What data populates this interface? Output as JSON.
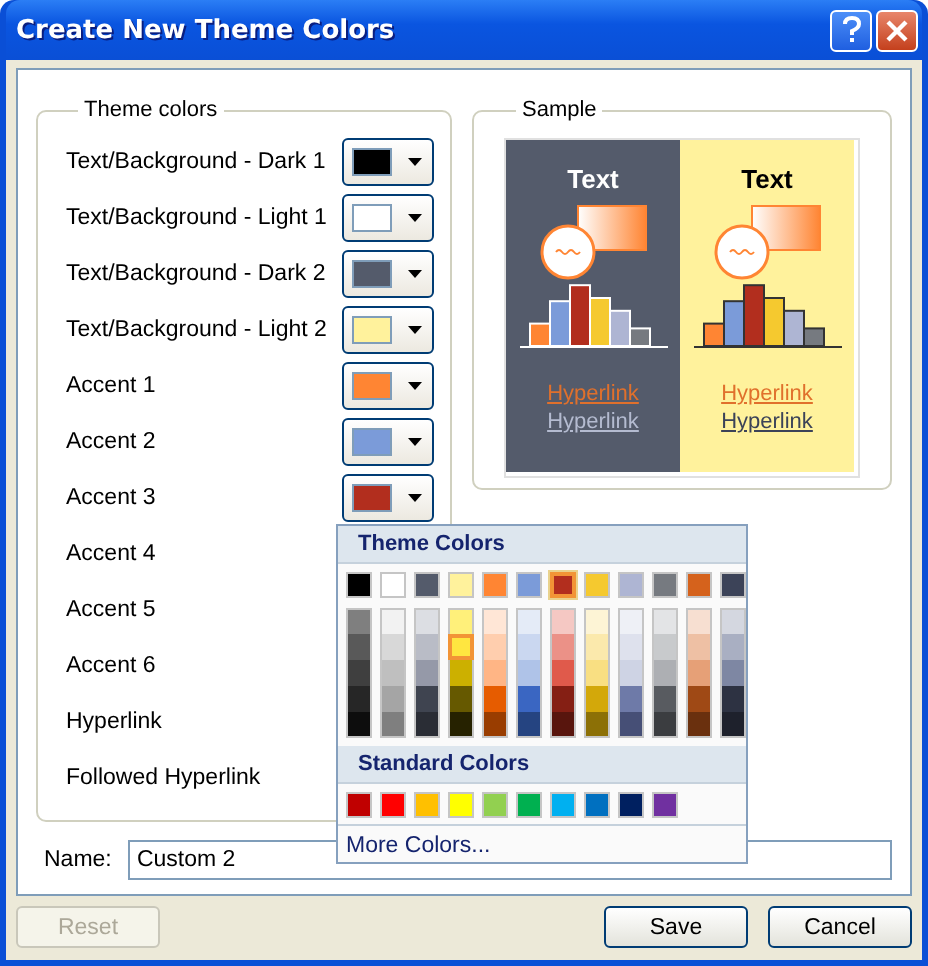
{
  "window": {
    "title": "Create New Theme Colors"
  },
  "theme_colors": {
    "title": "Theme colors",
    "rows": [
      {
        "label": "Text/Background - Dark 1",
        "color": "#000000"
      },
      {
        "label": "Text/Background - Light 1",
        "color": "#ffffff"
      },
      {
        "label": "Text/Background - Dark 2",
        "color": "#545b6b"
      },
      {
        "label": "Text/Background - Light 2",
        "color": "#fff29c"
      },
      {
        "label": "Accent 1",
        "color": "#ff8533"
      },
      {
        "label": "Accent 2",
        "color": "#7b9bd9"
      },
      {
        "label": "Accent 3",
        "color": "#b22e1e"
      },
      {
        "label": "Accent 4"
      },
      {
        "label": "Accent 5"
      },
      {
        "label": "Accent 6"
      },
      {
        "label": "Hyperlink"
      },
      {
        "label": "Followed Hyperlink"
      }
    ]
  },
  "sample": {
    "title": "Sample",
    "panels": [
      {
        "kind": "dark",
        "heading": "Text",
        "hyperlink": "Hyperlink",
        "followed_hyperlink": "Hyperlink"
      },
      {
        "kind": "light",
        "heading": "Text",
        "hyperlink": "Hyperlink",
        "followed_hyperlink": "Hyperlink"
      }
    ]
  },
  "palette": {
    "theme_title": "Theme Colors",
    "theme_row": [
      {
        "color": "#000000",
        "selected": false
      },
      {
        "color": "#ffffff",
        "selected": false
      },
      {
        "color": "#545b6b",
        "selected": false
      },
      {
        "color": "#fff29c",
        "selected": false
      },
      {
        "color": "#ff8533",
        "selected": false
      },
      {
        "color": "#7b9bd9",
        "selected": false
      },
      {
        "color": "#b22e1e",
        "selected": true
      },
      {
        "color": "#f5c92f",
        "selected": false
      },
      {
        "color": "#aeb5d3",
        "selected": false
      },
      {
        "color": "#767a80",
        "selected": false
      },
      {
        "color": "#d5621c",
        "selected": false
      },
      {
        "color": "#3c4358",
        "selected": false
      }
    ],
    "shades": [
      [
        {
          "color": "#7f7f7f",
          "selected": false
        },
        {
          "color": "#f2f2f2",
          "selected": false
        },
        {
          "color": "#dcdee3",
          "selected": false
        },
        {
          "color": "#fff07a",
          "selected": false
        },
        {
          "color": "#ffe6d6",
          "selected": false
        },
        {
          "color": "#e4ebf7",
          "selected": false
        },
        {
          "color": "#f5c8c3",
          "selected": false
        },
        {
          "color": "#fdf4d5",
          "selected": false
        },
        {
          "color": "#eef0f6",
          "selected": false
        },
        {
          "color": "#e3e4e6",
          "selected": false
        },
        {
          "color": "#f7dfd1",
          "selected": false
        },
        {
          "color": "#d4d7e0",
          "selected": false
        }
      ],
      [
        {
          "color": "#595959",
          "selected": false
        },
        {
          "color": "#d8d8d8",
          "selected": false
        },
        {
          "color": "#b9bcc6",
          "selected": false
        },
        {
          "color": "#ffe640",
          "selected": true
        },
        {
          "color": "#ffceae",
          "selected": false
        },
        {
          "color": "#cad7f0",
          "selected": false
        },
        {
          "color": "#eb9187",
          "selected": false
        },
        {
          "color": "#fbe9ac",
          "selected": false
        },
        {
          "color": "#dee1ed",
          "selected": false
        },
        {
          "color": "#c8cacc",
          "selected": false
        },
        {
          "color": "#eec0a4",
          "selected": false
        },
        {
          "color": "#a9afc2",
          "selected": false
        }
      ],
      [
        {
          "color": "#3f3f3f",
          "selected": false
        },
        {
          "color": "#bfbfbf",
          "selected": false
        },
        {
          "color": "#9599a8",
          "selected": false
        },
        {
          "color": "#ccb000",
          "selected": false
        },
        {
          "color": "#ffb585",
          "selected": false
        },
        {
          "color": "#afc3e8",
          "selected": false
        },
        {
          "color": "#e05a4b",
          "selected": false
        },
        {
          "color": "#f9df82",
          "selected": false
        },
        {
          "color": "#ced3e4",
          "selected": false
        },
        {
          "color": "#adafb3",
          "selected": false
        },
        {
          "color": "#e6a077",
          "selected": false
        },
        {
          "color": "#7e87a3",
          "selected": false
        }
      ],
      [
        {
          "color": "#262626",
          "selected": false
        },
        {
          "color": "#a5a5a5",
          "selected": false
        },
        {
          "color": "#3f4450",
          "selected": false
        },
        {
          "color": "#665900",
          "selected": false
        },
        {
          "color": "#e65c00",
          "selected": false
        },
        {
          "color": "#3a66c2",
          "selected": false
        },
        {
          "color": "#851f14",
          "selected": false
        },
        {
          "color": "#d3a80a",
          "selected": false
        },
        {
          "color": "#6e7aa8",
          "selected": false
        },
        {
          "color": "#585b60",
          "selected": false
        },
        {
          "color": "#9f4915",
          "selected": false
        },
        {
          "color": "#2d3242",
          "selected": false
        }
      ],
      [
        {
          "color": "#0d0d0d",
          "selected": false
        },
        {
          "color": "#7f7f7f",
          "selected": false
        },
        {
          "color": "#2a2d35",
          "selected": false
        },
        {
          "color": "#262200",
          "selected": false
        },
        {
          "color": "#993d00",
          "selected": false
        },
        {
          "color": "#254481",
          "selected": false
        },
        {
          "color": "#58150d",
          "selected": false
        },
        {
          "color": "#8c7006",
          "selected": false
        },
        {
          "color": "#464f76",
          "selected": false
        },
        {
          "color": "#3b3d40",
          "selected": false
        },
        {
          "color": "#6a300e",
          "selected": false
        },
        {
          "color": "#1e212c",
          "selected": false
        }
      ]
    ],
    "standard_title": "Standard Colors",
    "standard": [
      {
        "color": "#c00000"
      },
      {
        "color": "#ff0000"
      },
      {
        "color": "#ffc000"
      },
      {
        "color": "#ffff00"
      },
      {
        "color": "#92d050"
      },
      {
        "color": "#00b050"
      },
      {
        "color": "#00b0f0"
      },
      {
        "color": "#0070c0"
      },
      {
        "color": "#002060"
      },
      {
        "color": "#7030a0"
      }
    ],
    "more_link": "More Colors..."
  },
  "name_field": {
    "label": "Name:",
    "value": "Custom 2"
  },
  "buttons": [
    {
      "label": "Reset",
      "disabled": true
    },
    {
      "label": "Save",
      "disabled": false
    },
    {
      "label": "Cancel",
      "disabled": false
    }
  ]
}
